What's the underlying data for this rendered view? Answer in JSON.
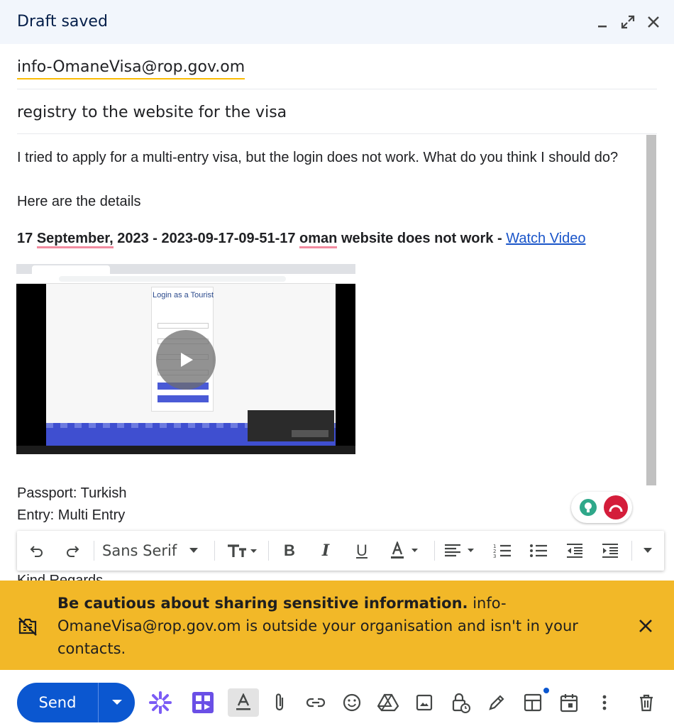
{
  "header": {
    "title": "Draft saved"
  },
  "recipients": {
    "to": "info-OmaneVisa@rop.gov.om"
  },
  "subject": "registry to the website for the visa",
  "body": {
    "line1": "I tried to apply for a multi-entry visa, but the login does not work. What do you think I should do?",
    "line2": "Here are the details",
    "heading_part1": "17 ",
    "heading_september": "September,",
    "heading_part2": " 2023 - 2023-09-17-09-51-17 ",
    "heading_oman": "oman",
    "heading_part3": " website does not work - ",
    "watch_video": "Watch Video",
    "video": {
      "card_title": "Login as a Tourist"
    },
    "passport": "Passport: Turkish",
    "entry": "Entry: Multi Entry",
    "kind": "Kind Regards"
  },
  "toolbar": {
    "font": "Sans Serif",
    "icons": [
      "undo-icon",
      "redo-icon",
      "text-size-icon",
      "bold-icon",
      "italic-icon",
      "underline-icon",
      "text-color-icon",
      "align-icon",
      "numbered-list-icon",
      "bulleted-list-icon",
      "indent-less-icon",
      "indent-more-icon",
      "more-formatting-icon"
    ]
  },
  "warning": {
    "bold": "Be cautious about sharing sensitive information.",
    "rest": " info-OmaneVisa@rop.gov.om is outside your organisation and isn't in your contacts."
  },
  "bottom": {
    "send": "Send"
  },
  "colors": {
    "header_bg": "#f2f6fc",
    "send_bg": "#0b57d0",
    "warning_bg": "#f2b828",
    "link": "#1a55c9"
  }
}
